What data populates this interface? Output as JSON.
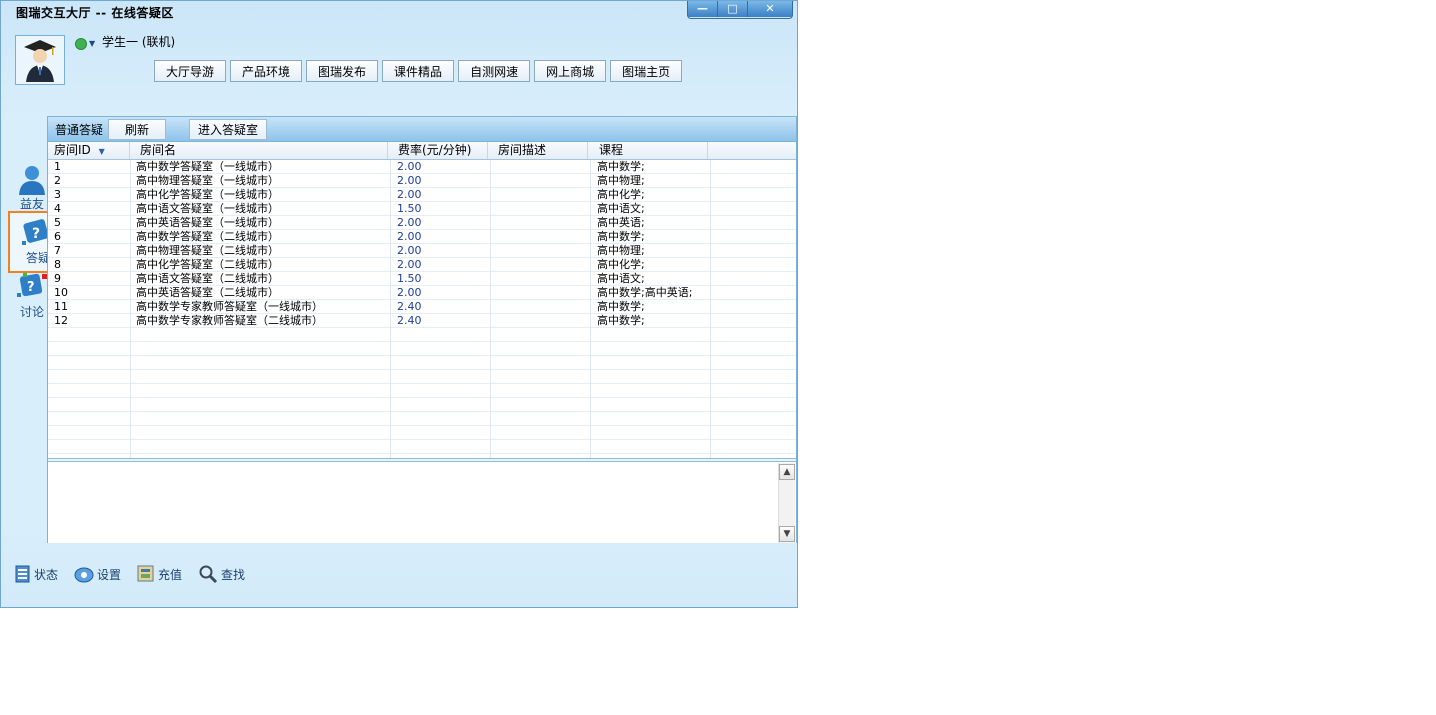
{
  "window": {
    "title": "图瑞交互大厅 -- 在线答疑区",
    "controls": {
      "minimize": "—",
      "maximize": "□",
      "close": "✕"
    }
  },
  "user": {
    "name": "学生一 (联机)",
    "avatar_icon": "graduate-avatar-icon",
    "status_color": "#3fb34f"
  },
  "navbar": [
    {
      "label": "大厅导游"
    },
    {
      "label": "产品环境"
    },
    {
      "label": "图瑞发布"
    },
    {
      "label": "课件精品"
    },
    {
      "label": "自测网速"
    },
    {
      "label": "网上商城"
    },
    {
      "label": "图瑞主页"
    }
  ],
  "sidebar": [
    {
      "label": "益友",
      "icon": "friend-icon"
    },
    {
      "label": "答疑",
      "icon": "question-icon",
      "active": true
    },
    {
      "label": "讨论",
      "icon": "discussion-icon"
    }
  ],
  "panel": {
    "tab_label": "普通答疑",
    "refresh_label": "刷新",
    "enter_label": "进入答疑室"
  },
  "table": {
    "columns": [
      "房间ID",
      "房间名",
      "费率(元/分钟)",
      "房间描述",
      "课程"
    ],
    "sort_indicator": "▼",
    "rows": [
      {
        "id": "1",
        "name": "高中数学答疑室（一线城市）",
        "rate": "2.00",
        "desc": "",
        "course": "高中数学;"
      },
      {
        "id": "2",
        "name": "高中物理答疑室（一线城市）",
        "rate": "2.00",
        "desc": "",
        "course": "高中物理;"
      },
      {
        "id": "3",
        "name": "高中化学答疑室（一线城市）",
        "rate": "2.00",
        "desc": "",
        "course": "高中化学;"
      },
      {
        "id": "4",
        "name": "高中语文答疑室（一线城市）",
        "rate": "1.50",
        "desc": "",
        "course": "高中语文;"
      },
      {
        "id": "5",
        "name": "高中英语答疑室（一线城市）",
        "rate": "2.00",
        "desc": "",
        "course": "高中英语;"
      },
      {
        "id": "6",
        "name": "高中数学答疑室（二线城市）",
        "rate": "2.00",
        "desc": "",
        "course": "高中数学;"
      },
      {
        "id": "7",
        "name": "高中物理答疑室（二线城市）",
        "rate": "2.00",
        "desc": "",
        "course": "高中物理;"
      },
      {
        "id": "8",
        "name": "高中化学答疑室（二线城市）",
        "rate": "2.00",
        "desc": "",
        "course": "高中化学;"
      },
      {
        "id": "9",
        "name": "高中语文答疑室（二线城市）",
        "rate": "1.50",
        "desc": "",
        "course": "高中语文;"
      },
      {
        "id": "10",
        "name": "高中英语答疑室（二线城市）",
        "rate": "2.00",
        "desc": "",
        "course": "高中数学;高中英语;"
      },
      {
        "id": "11",
        "name": "高中数学专家教师答疑室（一线城市）",
        "rate": "2.40",
        "desc": "",
        "course": "高中数学;"
      },
      {
        "id": "12",
        "name": "高中数学专家教师答疑室（二线城市）",
        "rate": "2.40",
        "desc": "",
        "course": "高中数学;"
      }
    ]
  },
  "scroll": {
    "up": "▲",
    "down": "▼"
  },
  "bottombar": [
    {
      "label": "状态",
      "icon": "status-icon"
    },
    {
      "label": "设置",
      "icon": "settings-icon"
    },
    {
      "label": "充值",
      "icon": "recharge-icon"
    },
    {
      "label": "查找",
      "icon": "search-icon"
    }
  ]
}
